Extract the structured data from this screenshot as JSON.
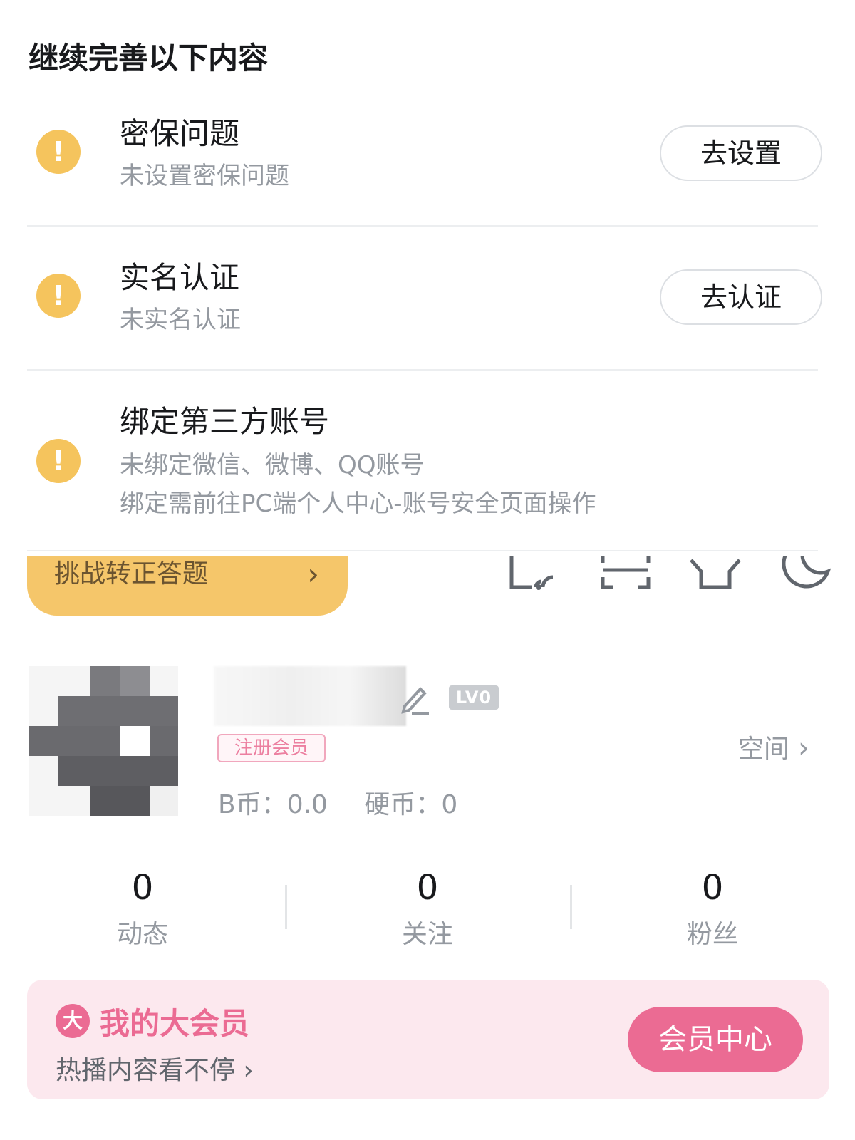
{
  "card": {
    "title": "继续完善以下内容",
    "tasks": [
      {
        "name": "密保问题",
        "desc": [
          "未设置密保问题"
        ],
        "button": "去设置",
        "icon": "warning-icon"
      },
      {
        "name": "实名认证",
        "desc": [
          "未实名认证"
        ],
        "button": "去认证",
        "icon": "warning-icon"
      },
      {
        "name": "绑定第三方账号",
        "desc": [
          "未绑定微信、微博、QQ账号",
          "绑定需前往PC端个人中心-账号安全页面操作"
        ],
        "icon": "warning-icon"
      }
    ]
  },
  "challenge": {
    "label": "挑战转正答题",
    "chevron": "›"
  },
  "top_icons": [
    "cast-icon",
    "scan-icon",
    "dress-up-icon",
    "night-mode-icon"
  ],
  "profile": {
    "level": "LV0",
    "member_tag": "注册会员",
    "space_label": "空间",
    "space_chevron": "›",
    "b_coin": "B币：0.0",
    "hard_coin": "硬币：0"
  },
  "stats": [
    {
      "value": "0",
      "label": "动态"
    },
    {
      "value": "0",
      "label": "关注"
    },
    {
      "value": "0",
      "label": "粉丝"
    }
  ],
  "vip": {
    "badge": "大",
    "title": "我的大会员",
    "subtitle": "热播内容看不停 ›",
    "button": "会员中心"
  },
  "colors": {
    "warning": "#f5c45d",
    "challenge_bg": "#f5c66a",
    "vip_pink": "#eb6b93",
    "vip_card_bg": "#fce8ee",
    "muted_text": "#9499a0"
  }
}
